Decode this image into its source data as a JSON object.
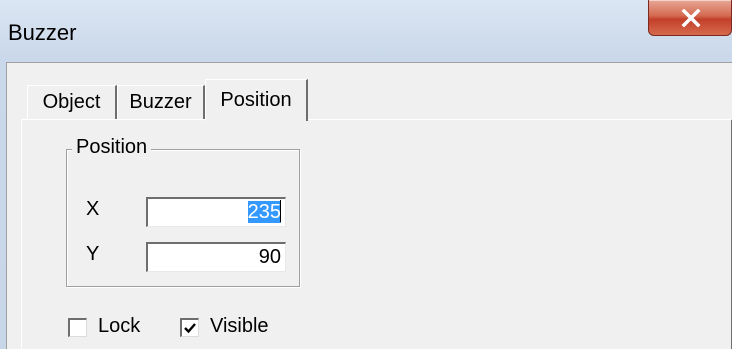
{
  "window": {
    "title": "Buzzer",
    "close_icon": "close-x-icon"
  },
  "tabs": [
    {
      "label": "Object",
      "active": false
    },
    {
      "label": "Buzzer",
      "active": false
    },
    {
      "label": "Position",
      "active": true
    }
  ],
  "position_group": {
    "label": "Position",
    "x_label": "X",
    "x_value": "235",
    "y_label": "Y",
    "y_value": "90"
  },
  "options": {
    "lock": {
      "label": "Lock",
      "checked": false
    },
    "visible": {
      "label": "Visible",
      "checked": true
    }
  },
  "colors": {
    "selection": "#3399ff",
    "close_button": "#c2402a",
    "dialog_face": "#f0f0f0"
  }
}
